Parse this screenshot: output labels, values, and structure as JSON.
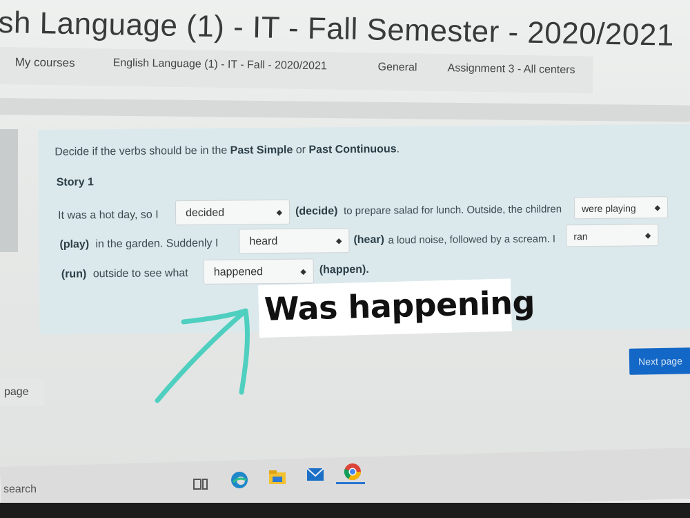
{
  "header": {
    "title": "sh Language (1) - IT - Fall Semester - 2020/2021"
  },
  "breadcrumb": [
    {
      "label": "My courses"
    },
    {
      "label": "English Language (1) - IT - Fall - 2020/2021"
    },
    {
      "label": "General"
    },
    {
      "label": "Assignment 3 - All centers"
    }
  ],
  "question": {
    "instruction_prefix": "Decide if the verbs should be in the ",
    "instruction_b1": "Past Simple",
    "instruction_mid": " or ",
    "instruction_b2": "Past Continuous",
    "instruction_suffix": ".",
    "story_title": "Story 1",
    "line1_text": "It was a hot day, so I",
    "line1_hint": "(decide)",
    "line1_after": "to prepare salad for lunch. Outside, the children",
    "line2_hint": "(play)",
    "line2_after": "in the garden. Suddenly I",
    "line2_hint2": "(hear)",
    "line2_after2": "a loud noise, followed by a scream. I",
    "line3_hint": "(run)",
    "line3_after": "outside to see what",
    "line3_hint2": "(happen).",
    "selects": {
      "decide": "decided",
      "play": "were playing",
      "hear": "heard",
      "run": "ran",
      "happen": "happened"
    }
  },
  "navigation": {
    "next_label": "Next page",
    "prev_label": "page"
  },
  "annotation": {
    "text": "Was happening",
    "arrow_color": "#4fcfbf"
  },
  "taskbar": {
    "search_text": "search",
    "icons": [
      "task-view-icon",
      "edge-icon",
      "file-explorer-icon",
      "mail-icon",
      "chrome-icon"
    ]
  }
}
